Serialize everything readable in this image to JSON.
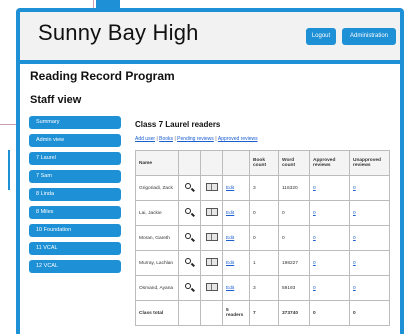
{
  "header": {
    "school_name": "Sunny Bay High",
    "logout_label": "Logout",
    "admin_label": "Administration"
  },
  "page": {
    "title": "Reading Record Program",
    "subtitle": "Staff view"
  },
  "sidebar": {
    "items": [
      {
        "label": "Summary"
      },
      {
        "label": "Admin view"
      },
      {
        "label": "7 Laurel"
      },
      {
        "label": "7 Sam"
      },
      {
        "label": "8 Linda"
      },
      {
        "label": "8 Miles"
      },
      {
        "label": "10 Foundation"
      },
      {
        "label": "11 VCAL"
      },
      {
        "label": "12 VCAL"
      }
    ]
  },
  "main": {
    "class_title": "Class 7 Laurel readers",
    "links": {
      "add_user": "Add user",
      "books": "Books",
      "pending": "Pending reviews",
      "approved": "Approved reviews"
    },
    "table": {
      "headers": [
        "Name",
        "",
        "",
        "",
        "Book count",
        "Word count",
        "Approved reviews",
        "Unapproved reviews"
      ],
      "rows": [
        {
          "name": "Grigoriadi, Zack",
          "edit": "Edit",
          "books": "3",
          "words": "116320",
          "approved": "0",
          "unapproved": "0"
        },
        {
          "name": "Lai, Jackie",
          "edit": "Edit",
          "books": "0",
          "words": "0",
          "approved": "0",
          "unapproved": "0"
        },
        {
          "name": "Moran, Gareth",
          "edit": "Edit",
          "books": "0",
          "words": "0",
          "approved": "0",
          "unapproved": "0"
        },
        {
          "name": "Murray, Lachlan",
          "edit": "Edit",
          "books": "1",
          "words": "198227",
          "approved": "0",
          "unapproved": "0"
        },
        {
          "name": "Osmand, Ayana",
          "edit": "Edit",
          "books": "3",
          "words": "59193",
          "approved": "0",
          "unapproved": "0"
        }
      ],
      "total": {
        "label": "Class total",
        "readers": "5 readers",
        "books": "7",
        "words": "373740",
        "approved": "0",
        "unapproved": "0"
      }
    }
  },
  "icons": {
    "search": "magnifier-icon",
    "book": "book-icon"
  },
  "colors": {
    "accent": "#1e90d6",
    "header_bg": "#f2f2f2",
    "link": "#1a5fd0"
  }
}
